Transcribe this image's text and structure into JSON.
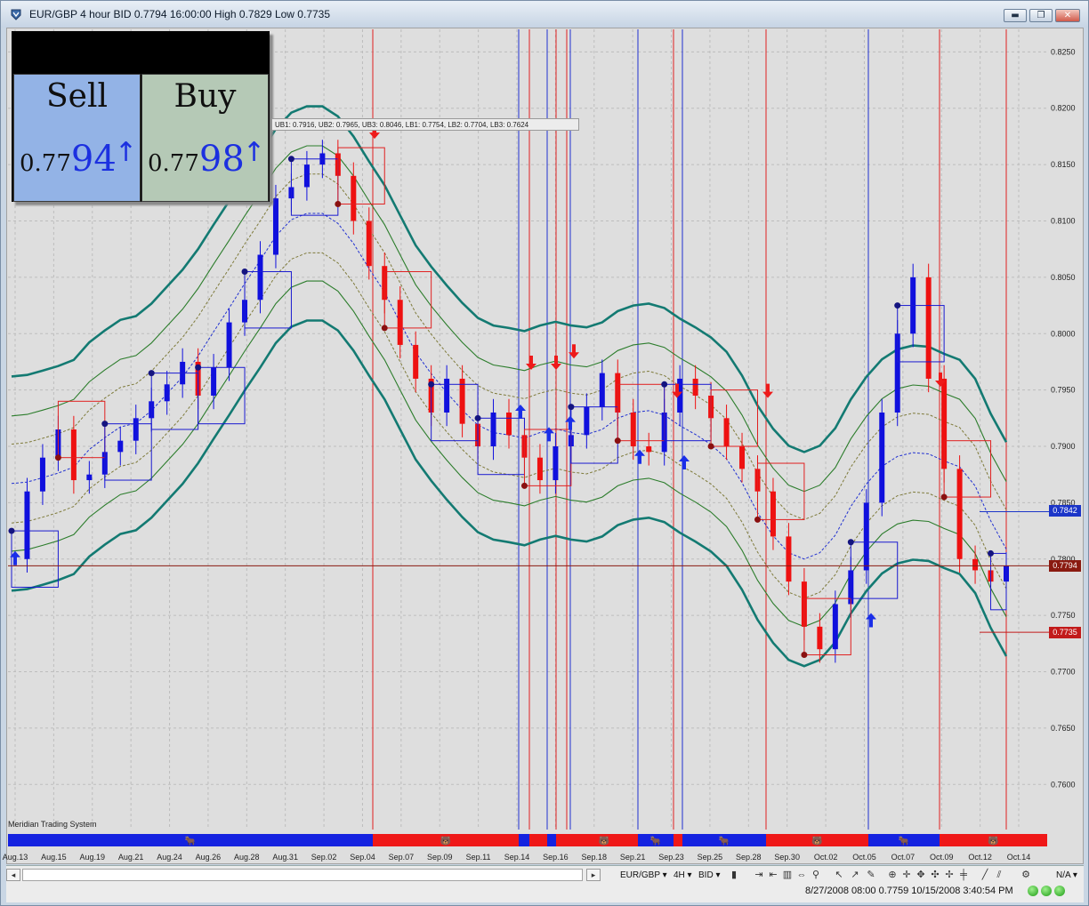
{
  "window": {
    "title": "EUR/GBP 4 hour BID 0.7794 16:00:00 High 0.7829 Low 0.7735",
    "controls": {
      "minimize": "▬",
      "maximize": "❐",
      "close": "✕"
    }
  },
  "quote_box": {
    "sell_label": "Sell",
    "sell_price_prefix": "0.77",
    "sell_price_big": "94",
    "buy_label": "Buy",
    "buy_price_prefix": "0.77",
    "buy_price_big": "98",
    "arrow": "↑"
  },
  "bands_readout": "UB1: 0.7916, UB2: 0.7965, UB3: 0.8046, LB1: 0.7754, LB2: 0.7704, LB3: 0.7624",
  "system_label": "Meridian Trading System",
  "price_tags": {
    "high": "0.7842",
    "current": "0.7794",
    "low": "0.7735"
  },
  "colors": {
    "up": "#1010dd",
    "down": "#ee1111",
    "band_outer": "#137a72",
    "band_mid": "#2c7d2c",
    "band_inner": "#7e7a3a",
    "grid": "#bdbdbd"
  },
  "chart_data": {
    "type": "candlestick",
    "title": "EUR/GBP 4 hour BID",
    "ylim": [
      0.756,
      0.827
    ],
    "y_ticks": [
      "0.8250",
      "0.8200",
      "0.8150",
      "0.8100",
      "0.8050",
      "0.8000",
      "0.7950",
      "0.7900",
      "0.7850",
      "0.7800",
      "0.7750",
      "0.7700",
      "0.7650",
      "0.7600"
    ],
    "x_labels": [
      "Aug.13",
      "Aug.15",
      "Aug.19",
      "Aug.21",
      "Aug.24",
      "Aug.26",
      "Aug.28",
      "Aug.31",
      "Sep.02",
      "Sep.04",
      "Sep.07",
      "Sep.09",
      "Sep.11",
      "Sep.14",
      "Sep.16",
      "Sep.18",
      "Sep.21",
      "Sep.23",
      "Sep.25",
      "Sep.28",
      "Sep.30",
      "Oct.02",
      "Oct.05",
      "Oct.07",
      "Oct.09",
      "Oct.12",
      "Oct.14"
    ],
    "close_path": [
      0.78,
      0.786,
      0.789,
      0.7915,
      0.787,
      0.7875,
      0.7895,
      0.7905,
      0.7925,
      0.794,
      0.7955,
      0.7975,
      0.7945,
      0.797,
      0.801,
      0.803,
      0.807,
      0.812,
      0.813,
      0.815,
      0.816,
      0.814,
      0.81,
      0.806,
      0.803,
      0.799,
      0.796,
      0.793,
      0.796,
      0.792,
      0.79,
      0.793,
      0.791,
      0.789,
      0.787,
      0.79,
      0.791,
      0.7935,
      0.7965,
      0.793,
      0.79,
      0.7895,
      0.793,
      0.796,
      0.7945,
      0.7925,
      0.79,
      0.788,
      0.786,
      0.782,
      0.778,
      0.774,
      0.772,
      0.776,
      0.779,
      0.785,
      0.793,
      0.8,
      0.805,
      0.796,
      0.788,
      0.78,
      0.779,
      0.778,
      0.7794
    ],
    "current": 0.7794,
    "high": 0.7842,
    "low": 0.7735,
    "date_range_start": "8/27/2008 08:00",
    "date_range_price": "0.7759",
    "cursor_time": "10/15/2008 3:40:54 PM"
  },
  "toolbar": {
    "symbol": "EUR/GBP ▾",
    "timeframe": "4H ▾",
    "side": "BID ▾",
    "na": "N/A ▾",
    "nav_prev": "◂",
    "nav_next": "▸"
  },
  "status": {
    "text": "8/27/2008 08:00  0.7759 10/15/2008 3:40:54 PM"
  },
  "bar_labels": {
    "bull": "🐂",
    "bear": "🐻"
  }
}
